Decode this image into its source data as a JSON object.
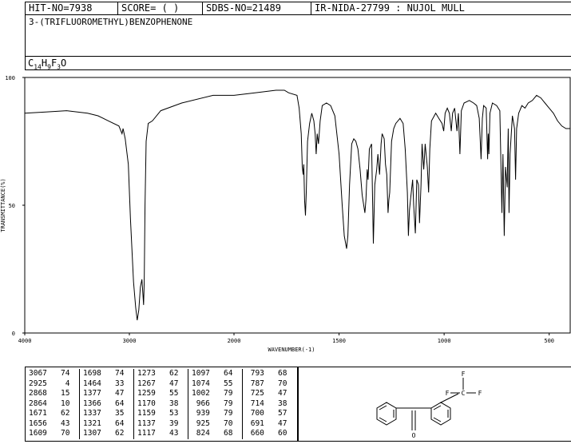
{
  "header": {
    "hit_no": "HIT-NO=7938",
    "score": "SCORE=  (   )",
    "sdbs_no": "SDBS-NO=21489",
    "ir_info": "IR-NIDA-27799 : NUJOL MULL",
    "compound": "3-(TRIFLUOROMETHYL)BENZOPHENONE",
    "formula_c": "C",
    "formula_c_n": "14",
    "formula_h": "H",
    "formula_h_n": "9",
    "formula_f": "F",
    "formula_f_n": "3",
    "formula_o": "O"
  },
  "chart_data": {
    "type": "line",
    "xlabel": "WAVENUMBER(-1)",
    "ylabel": "TRANSMITTANCE(%)",
    "xlim": [
      4000,
      400
    ],
    "ylim": [
      0,
      100
    ],
    "x_ticks": [
      "4000",
      "3000",
      "2000",
      "1500",
      "1000",
      "500"
    ],
    "y_ticks": [
      "0",
      "50",
      "100"
    ],
    "series": [
      {
        "points": [
          [
            4000,
            86
          ],
          [
            3800,
            86.5
          ],
          [
            3600,
            87
          ],
          [
            3400,
            86
          ],
          [
            3300,
            85
          ],
          [
            3200,
            83
          ],
          [
            3100,
            81
          ],
          [
            3070,
            78
          ],
          [
            3060,
            80
          ],
          [
            3040,
            76
          ],
          [
            3010,
            66
          ],
          [
            2990,
            45
          ],
          [
            2960,
            20
          ],
          [
            2940,
            10
          ],
          [
            2925,
            5
          ],
          [
            2910,
            9
          ],
          [
            2895,
            18
          ],
          [
            2880,
            21
          ],
          [
            2870,
            15
          ],
          [
            2864,
            11
          ],
          [
            2858,
            20
          ],
          [
            2850,
            50
          ],
          [
            2840,
            75
          ],
          [
            2820,
            82
          ],
          [
            2780,
            83
          ],
          [
            2700,
            87
          ],
          [
            2500,
            90
          ],
          [
            2200,
            93
          ],
          [
            2000,
            93
          ],
          [
            1900,
            94
          ],
          [
            1800,
            95
          ],
          [
            1760,
            95
          ],
          [
            1740,
            94
          ],
          [
            1700,
            93
          ],
          [
            1690,
            88
          ],
          [
            1680,
            78
          ],
          [
            1675,
            65
          ],
          [
            1671,
            62
          ],
          [
            1668,
            66
          ],
          [
            1664,
            52
          ],
          [
            1660,
            46
          ],
          [
            1656,
            55
          ],
          [
            1650,
            75
          ],
          [
            1640,
            82
          ],
          [
            1630,
            86
          ],
          [
            1620,
            83
          ],
          [
            1614,
            78
          ],
          [
            1609,
            70
          ],
          [
            1604,
            78
          ],
          [
            1598,
            74
          ],
          [
            1590,
            83
          ],
          [
            1580,
            89
          ],
          [
            1560,
            90
          ],
          [
            1540,
            89
          ],
          [
            1520,
            85
          ],
          [
            1500,
            70
          ],
          [
            1485,
            50
          ],
          [
            1475,
            38
          ],
          [
            1464,
            33
          ],
          [
            1458,
            38
          ],
          [
            1450,
            58
          ],
          [
            1440,
            74
          ],
          [
            1430,
            76
          ],
          [
            1420,
            75
          ],
          [
            1410,
            72
          ],
          [
            1400,
            64
          ],
          [
            1390,
            54
          ],
          [
            1377,
            47
          ],
          [
            1372,
            52
          ],
          [
            1366,
            64
          ],
          [
            1362,
            60
          ],
          [
            1356,
            72
          ],
          [
            1345,
            74
          ],
          [
            1337,
            35
          ],
          [
            1330,
            58
          ],
          [
            1321,
            64
          ],
          [
            1315,
            70
          ],
          [
            1307,
            62
          ],
          [
            1300,
            74
          ],
          [
            1295,
            78
          ],
          [
            1285,
            76
          ],
          [
            1279,
            66
          ],
          [
            1273,
            62
          ],
          [
            1267,
            47
          ],
          [
            1263,
            52
          ],
          [
            1259,
            55
          ],
          [
            1250,
            75
          ],
          [
            1240,
            80
          ],
          [
            1230,
            82
          ],
          [
            1210,
            84
          ],
          [
            1195,
            82
          ],
          [
            1185,
            72
          ],
          [
            1175,
            55
          ],
          [
            1170,
            38
          ],
          [
            1165,
            48
          ],
          [
            1159,
            53
          ],
          [
            1150,
            60
          ],
          [
            1145,
            50
          ],
          [
            1137,
            39
          ],
          [
            1130,
            60
          ],
          [
            1122,
            58
          ],
          [
            1117,
            43
          ],
          [
            1110,
            58
          ],
          [
            1105,
            74
          ],
          [
            1097,
            64
          ],
          [
            1090,
            74
          ],
          [
            1080,
            65
          ],
          [
            1074,
            55
          ],
          [
            1068,
            72
          ],
          [
            1060,
            83
          ],
          [
            1040,
            86
          ],
          [
            1025,
            84
          ],
          [
            1010,
            82
          ],
          [
            1002,
            79
          ],
          [
            995,
            86
          ],
          [
            985,
            88
          ],
          [
            975,
            86
          ],
          [
            966,
            79
          ],
          [
            960,
            86
          ],
          [
            950,
            88
          ],
          [
            939,
            79
          ],
          [
            932,
            86
          ],
          [
            925,
            70
          ],
          [
            918,
            87
          ],
          [
            905,
            90
          ],
          [
            880,
            91
          ],
          [
            860,
            90
          ],
          [
            845,
            89
          ],
          [
            833,
            84
          ],
          [
            824,
            68
          ],
          [
            818,
            84
          ],
          [
            812,
            89
          ],
          [
            800,
            88
          ],
          [
            793,
            68
          ],
          [
            790,
            78
          ],
          [
            787,
            70
          ],
          [
            782,
            86
          ],
          [
            770,
            90
          ],
          [
            750,
            89
          ],
          [
            735,
            87
          ],
          [
            725,
            47
          ],
          [
            720,
            70
          ],
          [
            714,
            38
          ],
          [
            708,
            65
          ],
          [
            700,
            57
          ],
          [
            695,
            80
          ],
          [
            691,
            47
          ],
          [
            686,
            70
          ],
          [
            675,
            85
          ],
          [
            665,
            80
          ],
          [
            660,
            60
          ],
          [
            655,
            80
          ],
          [
            645,
            86
          ],
          [
            630,
            89
          ],
          [
            615,
            88
          ],
          [
            600,
            90
          ],
          [
            580,
            91
          ],
          [
            560,
            93
          ],
          [
            540,
            92
          ],
          [
            520,
            90
          ],
          [
            500,
            88
          ],
          [
            480,
            86
          ],
          [
            460,
            83
          ],
          [
            440,
            81
          ],
          [
            420,
            80
          ],
          [
            400,
            80
          ]
        ]
      }
    ]
  },
  "peaks": {
    "col1": [
      [
        "3067",
        "74"
      ],
      [
        "2925",
        "4"
      ],
      [
        "2868",
        "15"
      ],
      [
        "2864",
        "10"
      ],
      [
        "1671",
        "62"
      ],
      [
        "1656",
        "43"
      ],
      [
        "1609",
        "70"
      ]
    ],
    "col2": [
      [
        "1698",
        "74"
      ],
      [
        "1464",
        "33"
      ],
      [
        "1377",
        "47"
      ],
      [
        "1366",
        "64"
      ],
      [
        "1337",
        "35"
      ],
      [
        "1321",
        "64"
      ],
      [
        "1307",
        "62"
      ]
    ],
    "col3": [
      [
        "1273",
        "62"
      ],
      [
        "1267",
        "47"
      ],
      [
        "1259",
        "55"
      ],
      [
        "1170",
        "38"
      ],
      [
        "1159",
        "53"
      ],
      [
        "1137",
        "39"
      ],
      [
        "1117",
        "43"
      ]
    ],
    "col4": [
      [
        "1097",
        "64"
      ],
      [
        "1074",
        "55"
      ],
      [
        "1002",
        "79"
      ],
      [
        "966",
        "79"
      ],
      [
        "939",
        "79"
      ],
      [
        "925",
        "70"
      ],
      [
        "824",
        "68"
      ]
    ],
    "col5": [
      [
        "793",
        "68"
      ],
      [
        "787",
        "70"
      ],
      [
        "725",
        "47"
      ],
      [
        "714",
        "38"
      ],
      [
        "700",
        "57"
      ],
      [
        "691",
        "47"
      ],
      [
        "660",
        "60"
      ]
    ]
  },
  "structure": {
    "atom_f1": "F",
    "atom_f2": "F",
    "atom_f3": "F",
    "atom_c": "C",
    "atom_o": "O"
  }
}
